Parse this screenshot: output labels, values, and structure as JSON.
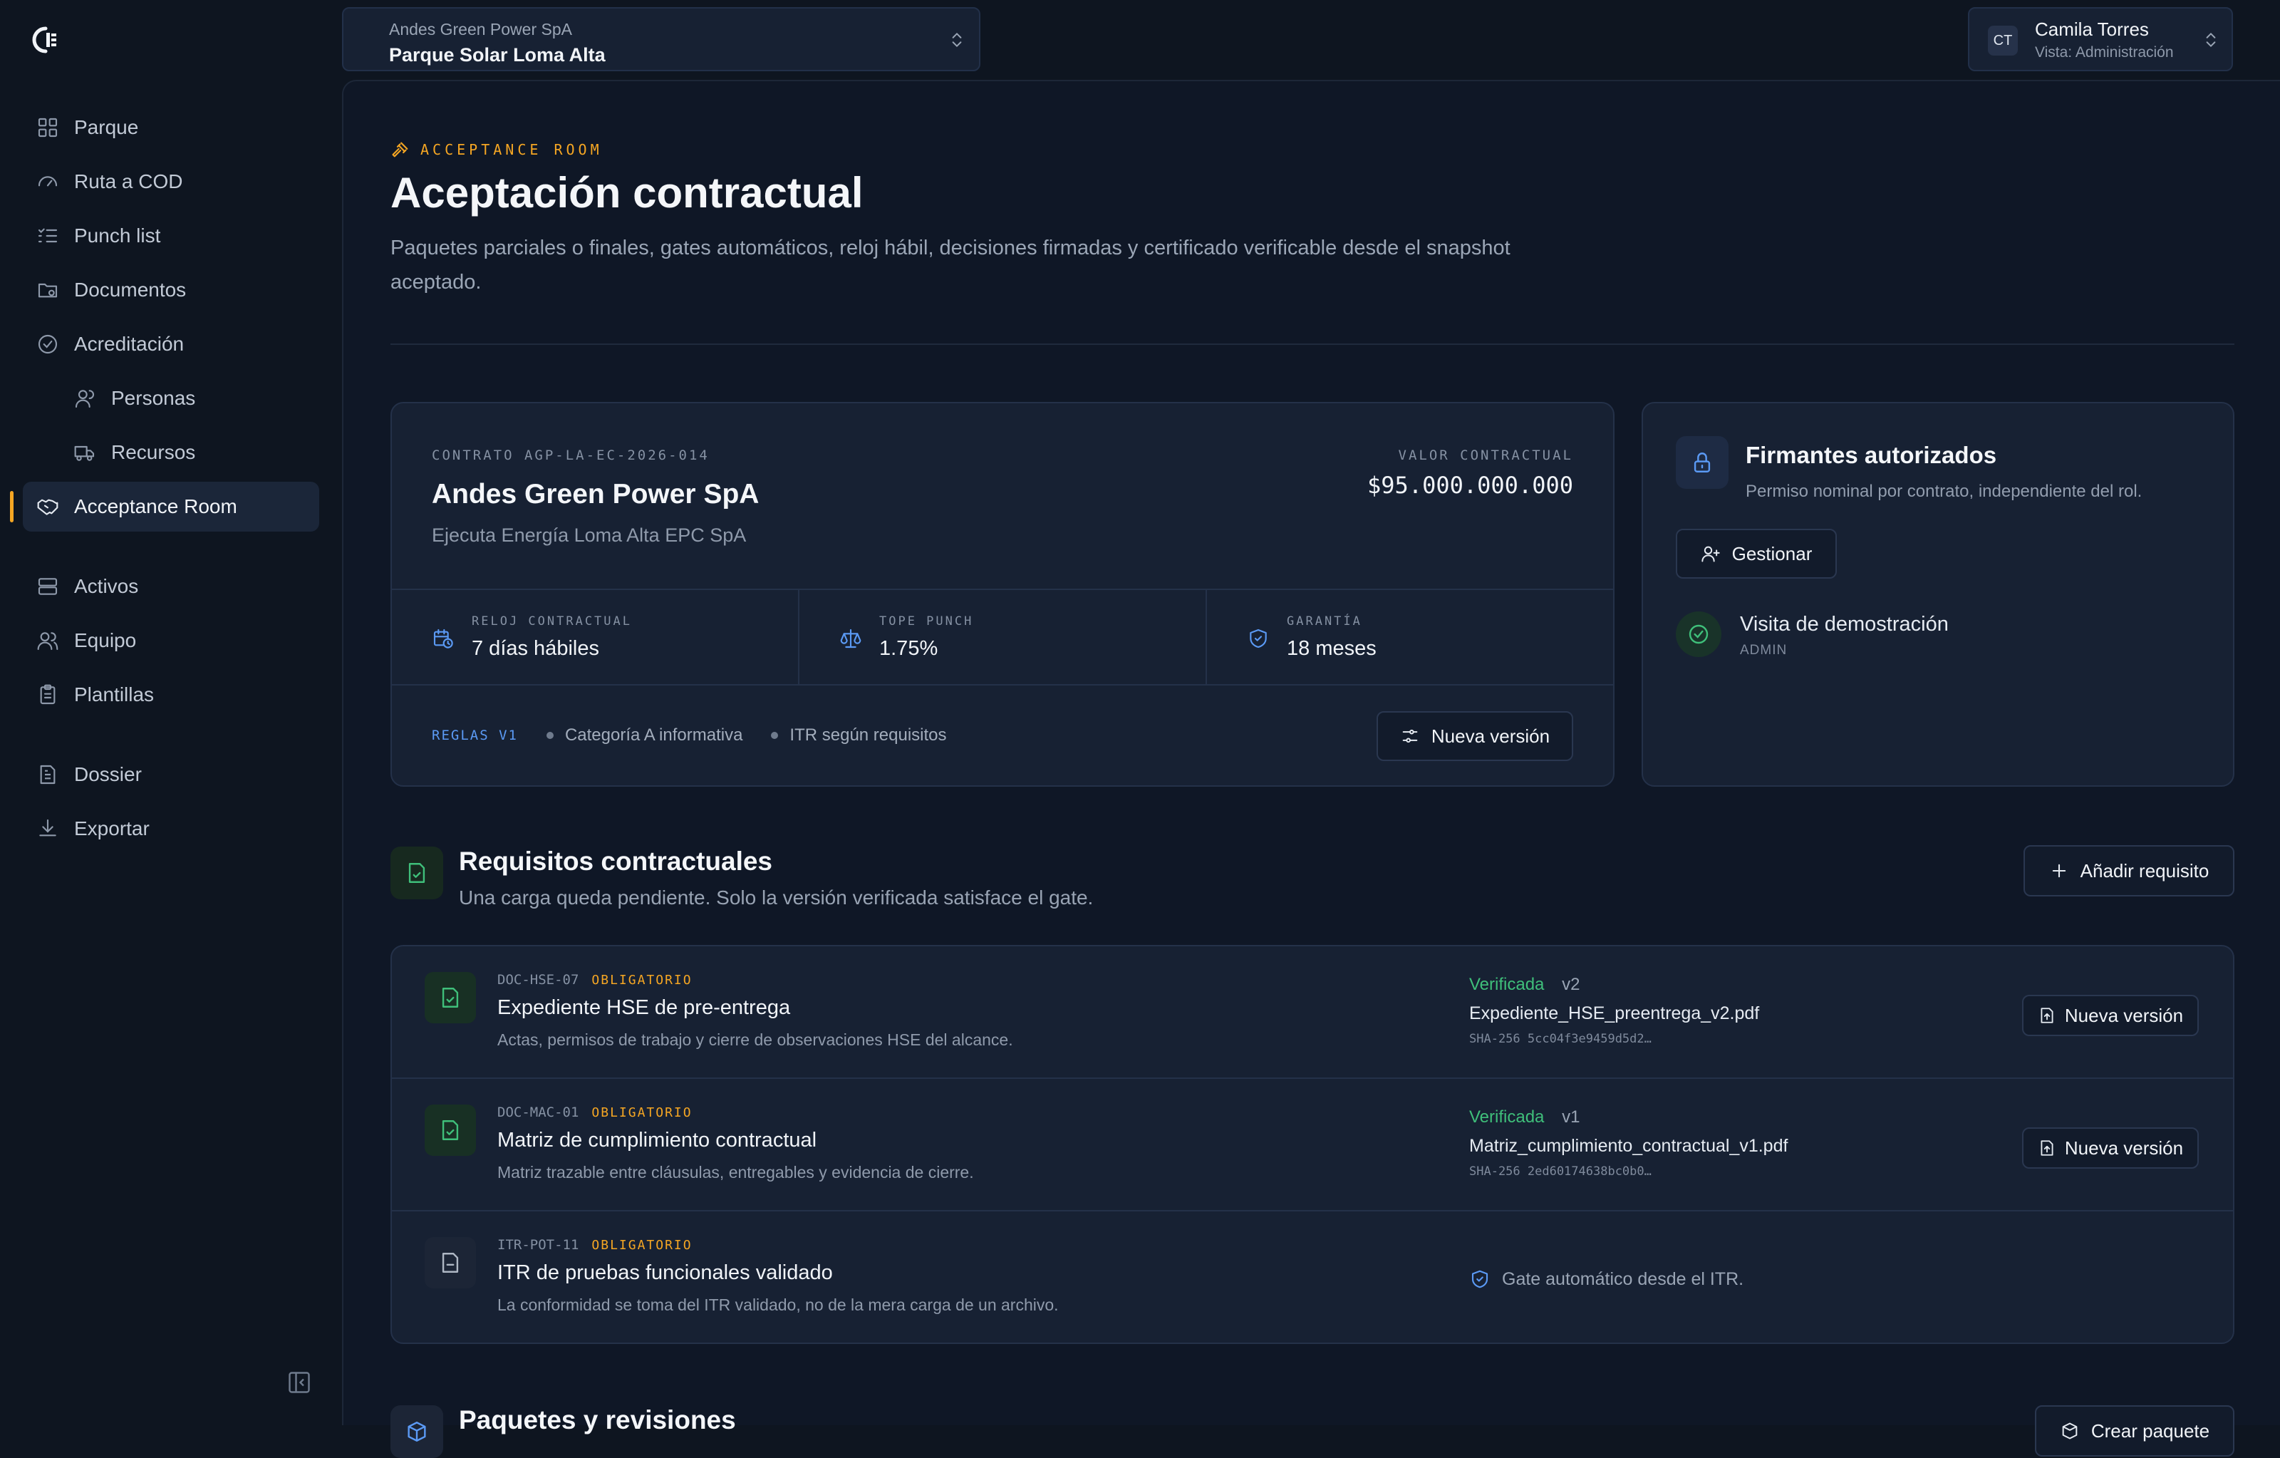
{
  "nav": {
    "items": [
      {
        "label": "Parque",
        "icon": "grid-icon"
      },
      {
        "label": "Ruta a COD",
        "icon": "gauge-icon"
      },
      {
        "label": "Punch list",
        "icon": "checklist-icon"
      },
      {
        "label": "Documentos",
        "icon": "folder-icon"
      },
      {
        "label": "Acreditación",
        "icon": "check-circle-icon"
      },
      {
        "label": "Personas",
        "icon": "user-icon"
      },
      {
        "label": "Recursos",
        "icon": "truck-icon"
      },
      {
        "label": "Acceptance Room",
        "icon": "handshake-icon"
      },
      {
        "label": "Activos",
        "icon": "server-icon"
      },
      {
        "label": "Equipo",
        "icon": "users-icon"
      },
      {
        "label": "Plantillas",
        "icon": "clipboard-icon"
      },
      {
        "label": "Dossier",
        "icon": "file-text-icon"
      },
      {
        "label": "Exportar",
        "icon": "download-icon"
      }
    ],
    "active_index": 7
  },
  "project": {
    "org": "Andes Green Power SpA",
    "name": "Parque Solar Loma Alta"
  },
  "user": {
    "initials": "CT",
    "name": "Camila Torres",
    "role": "Vista: Administración"
  },
  "header": {
    "eyebrow": "ACCEPTANCE ROOM",
    "title": "Aceptación contractual",
    "subtitle": "Paquetes parciales o finales, gates automáticos, reloj hábil, decisiones firmadas y certificado verificable desde el snapshot aceptado."
  },
  "contract": {
    "label": "CONTRATO AGP-LA-EC-2026-014",
    "name": "Andes Green Power SpA",
    "executor": "Ejecuta Energía Loma Alta EPC SpA",
    "value_label": "VALOR CONTRACTUAL",
    "value": "$95.000.000.000",
    "stats": [
      {
        "label": "RELOJ CONTRACTUAL",
        "value": "7 días hábiles",
        "icon": "calendar-clock-icon"
      },
      {
        "label": "TOPE PUNCH",
        "value": "1.75%",
        "icon": "scale-icon"
      },
      {
        "label": "GARANTÍA",
        "value": "18 meses",
        "icon": "shield-check-icon"
      }
    ],
    "rules_version": "REGLAS V1",
    "rules": [
      "Categoría A informativa",
      "ITR según requisitos"
    ],
    "new_version_label": "Nueva versión"
  },
  "signers": {
    "title": "Firmantes autorizados",
    "subtitle": "Permiso nominal por contrato, independiente del rol.",
    "manage_label": "Gestionar",
    "people": [
      {
        "name": "Visita de demostración",
        "role": "ADMIN"
      }
    ]
  },
  "requirements": {
    "title": "Requisitos contractuales",
    "subtitle": "Una carga queda pendiente. Solo la versión verificada satisface el gate.",
    "add_label": "Añadir requisito",
    "items": [
      {
        "code": "DOC-HSE-07",
        "badge": "OBLIGATORIO",
        "name": "Expediente HSE de pre-entrega",
        "description": "Actas, permisos de trabajo y cierre de observaciones HSE del alcance.",
        "status": "Verificada",
        "version": "v2",
        "file": "Expediente_HSE_preentrega_v2.pdf",
        "hash": "SHA-256 5cc04f3e9459d5d2…",
        "action": "Nueva versión"
      },
      {
        "code": "DOC-MAC-01",
        "badge": "OBLIGATORIO",
        "name": "Matriz de cumplimiento contractual",
        "description": "Matriz trazable entre cláusulas, entregables y evidencia de cierre.",
        "status": "Verificada",
        "version": "v1",
        "file": "Matriz_cumplimiento_contractual_v1.pdf",
        "hash": "SHA-256 2ed60174638bc0b0…",
        "action": "Nueva versión"
      },
      {
        "code": "ITR-POT-11",
        "badge": "OBLIGATORIO",
        "name": "ITR de pruebas funcionales validado",
        "description": "La conformidad se toma del ITR validado, no de la mera carga de un archivo.",
        "gate_note": "Gate automático desde el ITR."
      }
    ]
  },
  "packages": {
    "title": "Paquetes y revisiones",
    "create_label": "Crear paquete"
  },
  "colors": {
    "accent": "#f5a623",
    "success": "#3fbf7a",
    "link": "#5b9af5",
    "background": "#0e1520"
  }
}
